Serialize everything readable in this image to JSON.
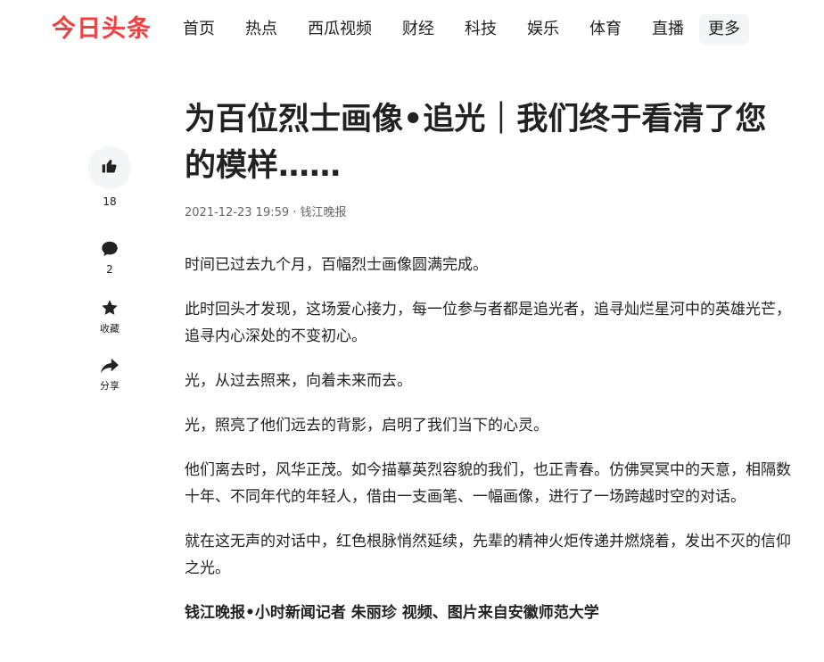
{
  "header": {
    "logo": "今日头条",
    "nav": [
      "首页",
      "热点",
      "西瓜视频",
      "财经",
      "科技",
      "娱乐",
      "体育",
      "直播"
    ],
    "more": "更多"
  },
  "sidebar": {
    "like_count": "18",
    "comment_count": "2",
    "favorite_label": "收藏",
    "share_label": "分享"
  },
  "article": {
    "title": "为百位烈士画像•追光｜我们终于看清了您的模样……",
    "meta": "2021-12-23 19:59 · 钱江晚报",
    "paragraphs": [
      "时间已过去九个月，百幅烈士画像圆满完成。",
      "此时回头才发现，这场爱心接力，每一位参与者都是追光者，追寻灿烂星河中的英雄光芒，追寻内心深处的不变初心。",
      "光，从过去照来，向着未来而去。",
      "光，照亮了他们远去的背影，启明了我们当下的心灵。",
      "他们离去时，风华正茂。如今描摹英烈容貌的我们，也正青春。仿佛冥冥中的天意，相隔数十年、不同年代的年轻人，借由一支画笔、一幅画像，进行了一场跨越时空的对话。",
      "就在这无声的对话中，红色根脉悄然延续，先辈的精神火炬传递并燃烧着，发出不灭的信仰之光。"
    ],
    "byline": "钱江晚报•小时新闻记者 朱丽珍 视频、图片来自安徽师范大学"
  },
  "colors": {
    "brand_red": "#f04142",
    "text": "#222222",
    "meta": "#666666",
    "button_bg": "#f4f5f6"
  }
}
